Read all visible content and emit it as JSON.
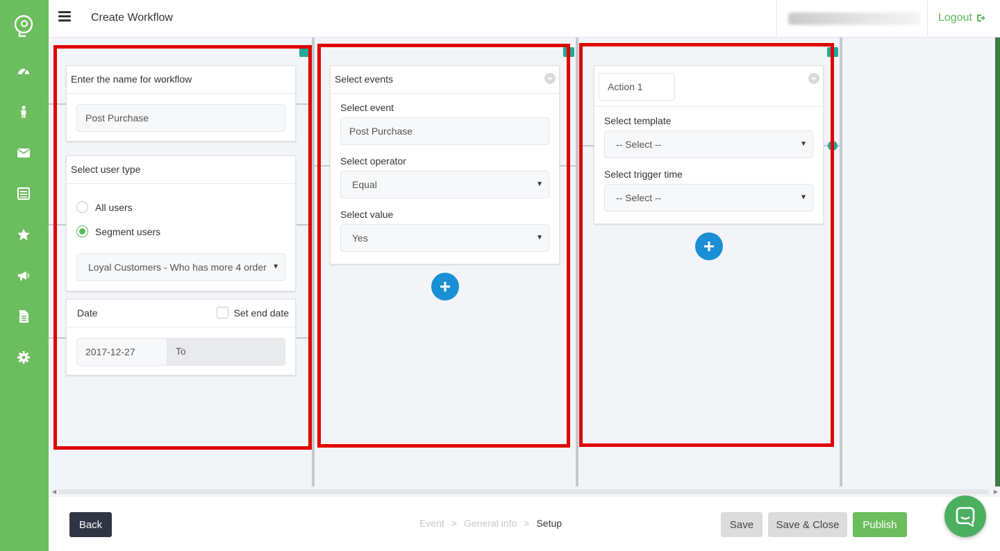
{
  "header": {
    "title": "Create Workflow",
    "logout_label": "Logout"
  },
  "sidebar": {
    "items": [
      "dashboard-icon",
      "user-icon",
      "email-icon",
      "list-icon",
      "star-icon",
      "megaphone-icon",
      "document-icon",
      "gear-icon"
    ]
  },
  "column1": {
    "name_card_title": "Enter the name for workflow",
    "name_value": "Post Purchase",
    "user_type_title": "Select user type",
    "radio_all": "All users",
    "radio_segment": "Segment users",
    "segment_value": "Loyal Customers - Who has more 4 order",
    "date_title": "Date",
    "set_end_date": "Set end date",
    "start_date": "2017-12-27",
    "end_date_placeholder": "To"
  },
  "column2": {
    "card_title": "Select events",
    "event_label": "Select event",
    "event_value": "Post Purchase",
    "operator_label": "Select operator",
    "operator_value": "Equal",
    "value_label": "Select value",
    "value_value": "Yes"
  },
  "column3": {
    "action_name": "Action 1",
    "template_label": "Select template",
    "template_value": "-- Select --",
    "trigger_label": "Select trigger time",
    "trigger_value": "-- Select --"
  },
  "footer": {
    "back_label": "Back",
    "crumbs": [
      "Event",
      "General info",
      "Setup"
    ],
    "separator": ">",
    "save_label": "Save",
    "save_close_label": "Save & Close",
    "publish_label": "Publish"
  },
  "colors": {
    "brand_green": "#6cbd5e",
    "accent_blue": "#1a8fd6",
    "annotation_red": "#e00000",
    "teal": "#26a69a"
  }
}
